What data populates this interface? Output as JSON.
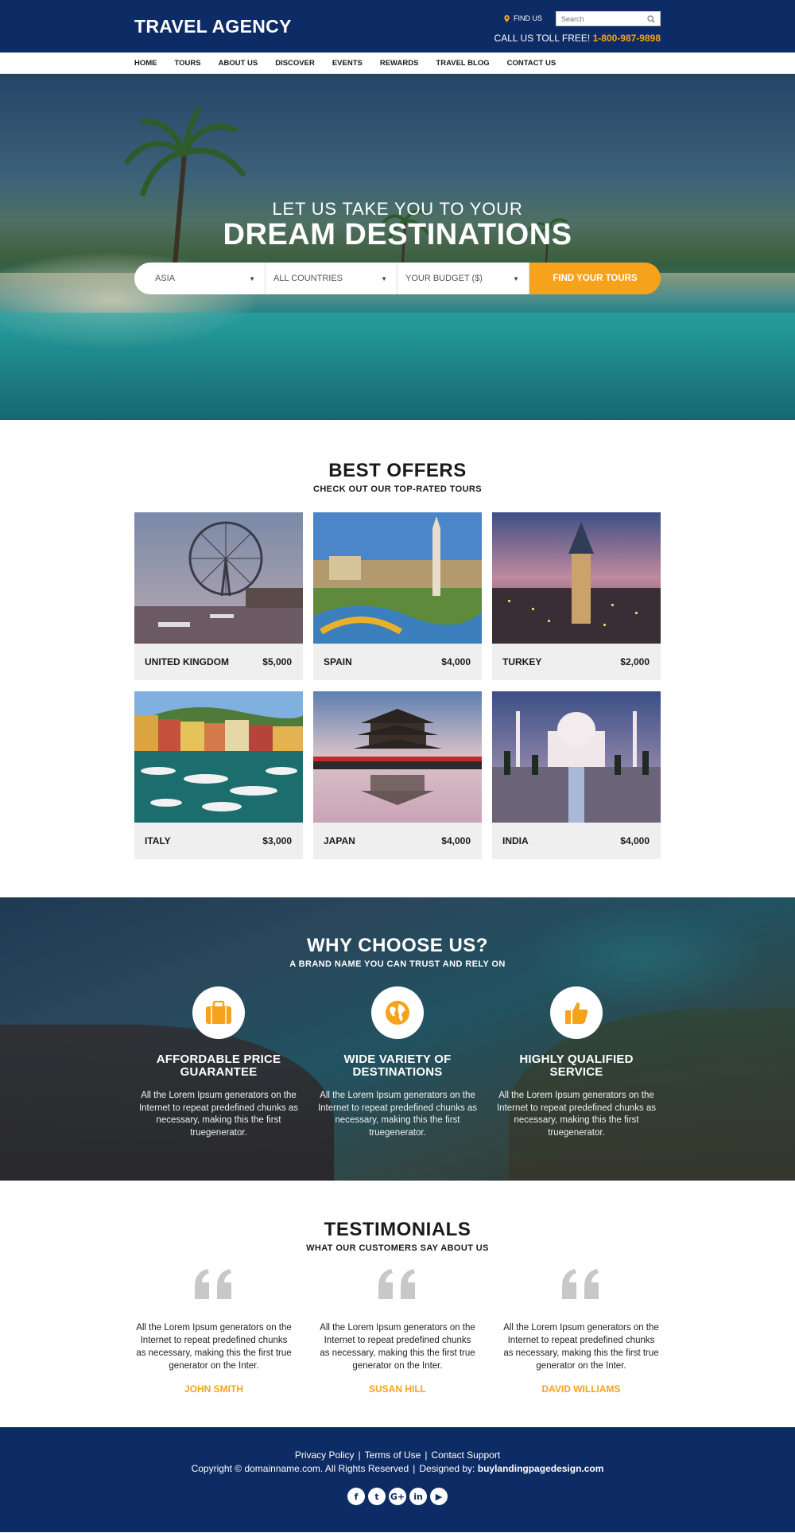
{
  "header": {
    "logo": "TRAVEL AGENCY",
    "find_us": "FIND US",
    "search_placeholder": "Search",
    "call_label": "CALL US TOLL FREE!",
    "phone": "1-800-987-9898"
  },
  "nav": {
    "items": [
      "HOME",
      "TOURS",
      "ABOUT US",
      "DISCOVER",
      "EVENTS",
      "REWARDS",
      "TRAVEL BLOG",
      "CONTACT US"
    ]
  },
  "hero": {
    "subtitle": "LET US TAKE YOU TO YOUR",
    "title": "DREAM DESTINATIONS",
    "region": "ASIA",
    "country": "ALL COUNTRIES",
    "budget": "YOUR BUDGET ($)",
    "button": "FIND YOUR TOURS"
  },
  "offers": {
    "title": "BEST OFFERS",
    "subtitle": "CHECK OUT OUR TOP-RATED TOURS",
    "items": [
      {
        "name": "UNITED KINGDOM",
        "price": "$5,000"
      },
      {
        "name": "SPAIN",
        "price": "$4,000"
      },
      {
        "name": "TURKEY",
        "price": "$2,000"
      },
      {
        "name": "ITALY",
        "price": "$3,000"
      },
      {
        "name": "JAPAN",
        "price": "$4,000"
      },
      {
        "name": "INDIA",
        "price": "$4,000"
      }
    ]
  },
  "why": {
    "title": "WHY CHOOSE US?",
    "subtitle": "A BRAND NAME YOU CAN TRUST AND RELY ON",
    "features": [
      {
        "icon": "briefcase-icon",
        "title_line1": "AFFORDABLE PRICE",
        "title_line2": "GUARANTEE",
        "text": "All the Lorem Ipsum generators on the Internet to repeat predefined chunks as necessary, making this the first truegenerator."
      },
      {
        "icon": "globe-icon",
        "title_line1": "WIDE VARIETY OF",
        "title_line2": "DESTINATIONS",
        "text": "All the Lorem Ipsum generators on the Internet to repeat predefined chunks as necessary, making this the first truegenerator."
      },
      {
        "icon": "thumbs-up-icon",
        "title_line1": "HIGHLY QUALIFIED",
        "title_line2": "SERVICE",
        "text": "All the Lorem Ipsum generators on the Internet to repeat predefined chunks as necessary, making this the first truegenerator."
      }
    ]
  },
  "testimonials": {
    "title": "TESTIMONIALS",
    "subtitle": "WHAT OUR CUSTOMERS SAY ABOUT US",
    "items": [
      {
        "text": "All the Lorem Ipsum generators on the Internet to repeat predefined chunks as necessary, making this the first true generator on the Inter.",
        "name": "JOHN SMITH"
      },
      {
        "text": "All the Lorem Ipsum generators on the Internet to repeat predefined chunks as necessary, making this the first true generator on the Inter.",
        "name": "SUSAN HILL"
      },
      {
        "text": "All the Lorem Ipsum generators on the Internet to repeat predefined chunks as necessary, making this the first true generator on the Inter.",
        "name": "DAVID WILLIAMS"
      }
    ]
  },
  "footer": {
    "privacy": "Privacy Policy",
    "terms": "Terms of Use",
    "support": "Contact Support",
    "copyright": "Copyright © domainname.com. All Rights Reserved",
    "designed_label": "Designed by:",
    "designer": "buylandingpagedesign.com",
    "social": [
      "facebook-icon",
      "twitter-icon",
      "google-plus-icon",
      "linkedin-icon",
      "youtube-icon"
    ]
  },
  "colors": {
    "navy": "#0d2b64",
    "accent": "#f7a21b"
  }
}
